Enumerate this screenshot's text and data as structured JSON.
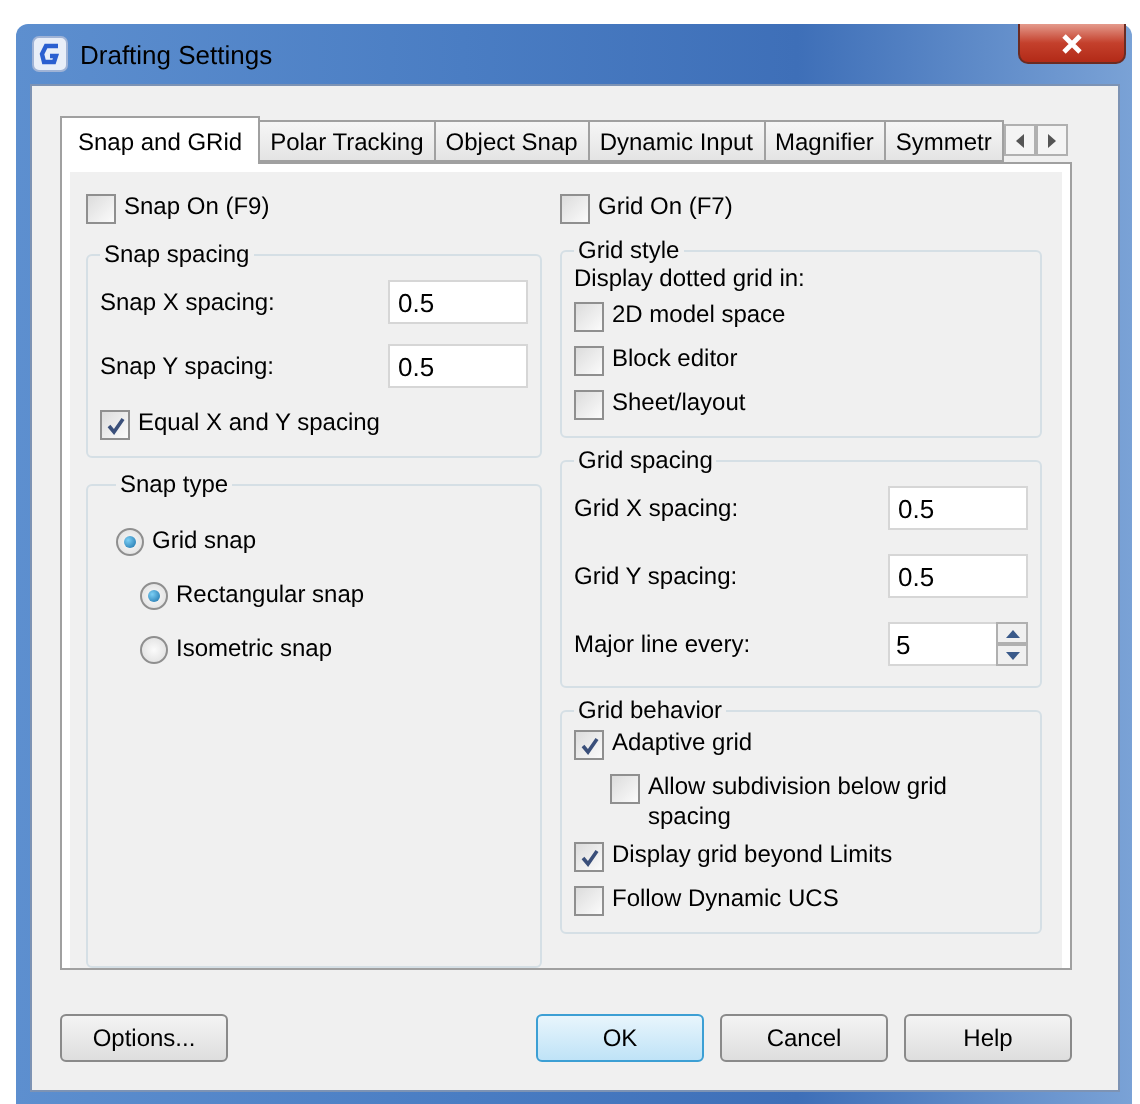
{
  "window": {
    "title": "Drafting Settings"
  },
  "tabs": [
    {
      "label": "Snap and GRid",
      "selected": true
    },
    {
      "label": "Polar Tracking",
      "selected": false
    },
    {
      "label": "Object Snap",
      "selected": false
    },
    {
      "label": "Dynamic Input",
      "selected": false
    },
    {
      "label": "Magnifier",
      "selected": false
    },
    {
      "label": "Symmetr",
      "selected": false
    }
  ],
  "snap_on": {
    "label": "Snap On (F9)",
    "checked": false
  },
  "grid_on": {
    "label": "Grid On (F7)",
    "checked": false
  },
  "snap_spacing": {
    "title": "Snap spacing",
    "fields": [
      {
        "label": "Snap X spacing:",
        "value": "0.5"
      },
      {
        "label": "Snap Y spacing:",
        "value": "0.5"
      }
    ],
    "equal": {
      "label": "Equal X and Y spacing",
      "checked": true
    }
  },
  "snap_type": {
    "title": "Snap type",
    "options": [
      {
        "label": "Grid snap",
        "selected": true,
        "children": [
          {
            "label": "Rectangular snap",
            "selected": true
          },
          {
            "label": "Isometric snap",
            "selected": false
          }
        ]
      }
    ]
  },
  "grid_style": {
    "title": "Grid style",
    "caption": "Display dotted grid in:",
    "options": [
      {
        "label": "2D model space",
        "checked": false
      },
      {
        "label": "Block editor",
        "checked": false
      },
      {
        "label": "Sheet/layout",
        "checked": false
      }
    ]
  },
  "grid_spacing": {
    "title": "Grid spacing",
    "fields": [
      {
        "label": "Grid X spacing:",
        "value": "0.5",
        "kind": "text"
      },
      {
        "label": "Grid Y spacing:",
        "value": "0.5",
        "kind": "text"
      },
      {
        "label": "Major line every:",
        "value": "5",
        "kind": "spinner"
      }
    ]
  },
  "grid_behavior": {
    "title": "Grid behavior",
    "options": [
      {
        "label": "Adaptive grid",
        "checked": true,
        "children": [
          {
            "label": "Allow subdivision below grid spacing",
            "checked": false
          }
        ]
      },
      {
        "label": "Display grid beyond Limits",
        "checked": true
      },
      {
        "label": "Follow Dynamic UCS",
        "checked": false
      }
    ]
  },
  "buttons": [
    {
      "label": "Options...",
      "default": false
    },
    {
      "label": "OK",
      "default": true
    },
    {
      "label": "Cancel",
      "default": false
    },
    {
      "label": "Help",
      "default": false
    }
  ]
}
